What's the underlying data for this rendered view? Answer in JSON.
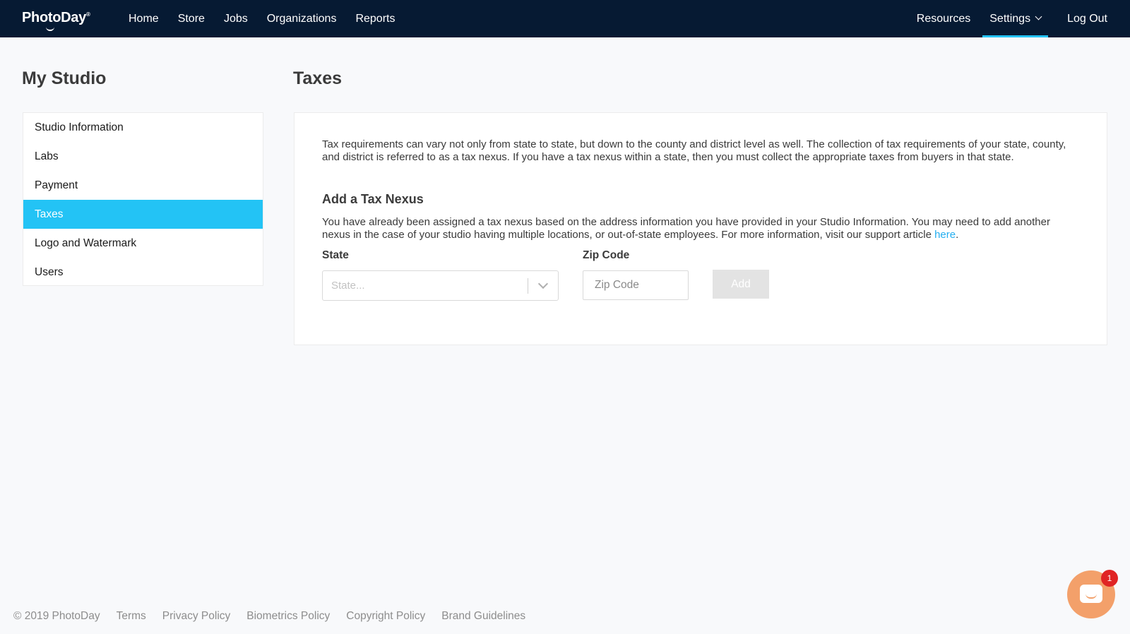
{
  "brand": {
    "name": "PhotoDay",
    "reg": "®"
  },
  "nav": {
    "left": [
      "Home",
      "Store",
      "Jobs",
      "Organizations",
      "Reports"
    ],
    "resources": "Resources",
    "settings": "Settings",
    "logout": "Log Out"
  },
  "sidebar": {
    "title": "My Studio",
    "items": [
      {
        "label": "Studio Information"
      },
      {
        "label": "Labs"
      },
      {
        "label": "Payment"
      },
      {
        "label": "Taxes"
      },
      {
        "label": "Logo and Watermark"
      },
      {
        "label": "Users"
      }
    ],
    "active_item": "Taxes"
  },
  "main": {
    "title": "Taxes",
    "intro": "Tax requirements can vary not only from state to state, but down to the county and district level as well. The collection of tax requirements of your state, county, and district is referred to as a tax nexus. If you have a tax nexus within a state, then you must collect the appropriate taxes from buyers in that state.",
    "nexus_title": "Add a Tax Nexus",
    "nexus_text": "You have already been assigned a tax nexus based on the address information you have provided in your Studio Information. You may need to add another nexus in the case of your studio having multiple locations, or out-of-state employees. For more information, visit our support article ",
    "nexus_link": "here",
    "nexus_end": ".",
    "state_label": "State",
    "state_placeholder": "State...",
    "zip_label": "Zip Code",
    "zip_placeholder": "Zip Code",
    "add_label": "Add"
  },
  "footer": {
    "copyright": "© 2019 PhotoDay",
    "links": [
      "Terms",
      "Privacy Policy",
      "Biometrics Policy",
      "Copyright Policy",
      "Brand Guidelines"
    ]
  },
  "chat": {
    "badge": "1"
  },
  "colors": {
    "topbar": "#061a33",
    "accent": "#23c3f5",
    "link": "#23aef0",
    "chat": "#f3a06a",
    "badge": "#e02424"
  }
}
